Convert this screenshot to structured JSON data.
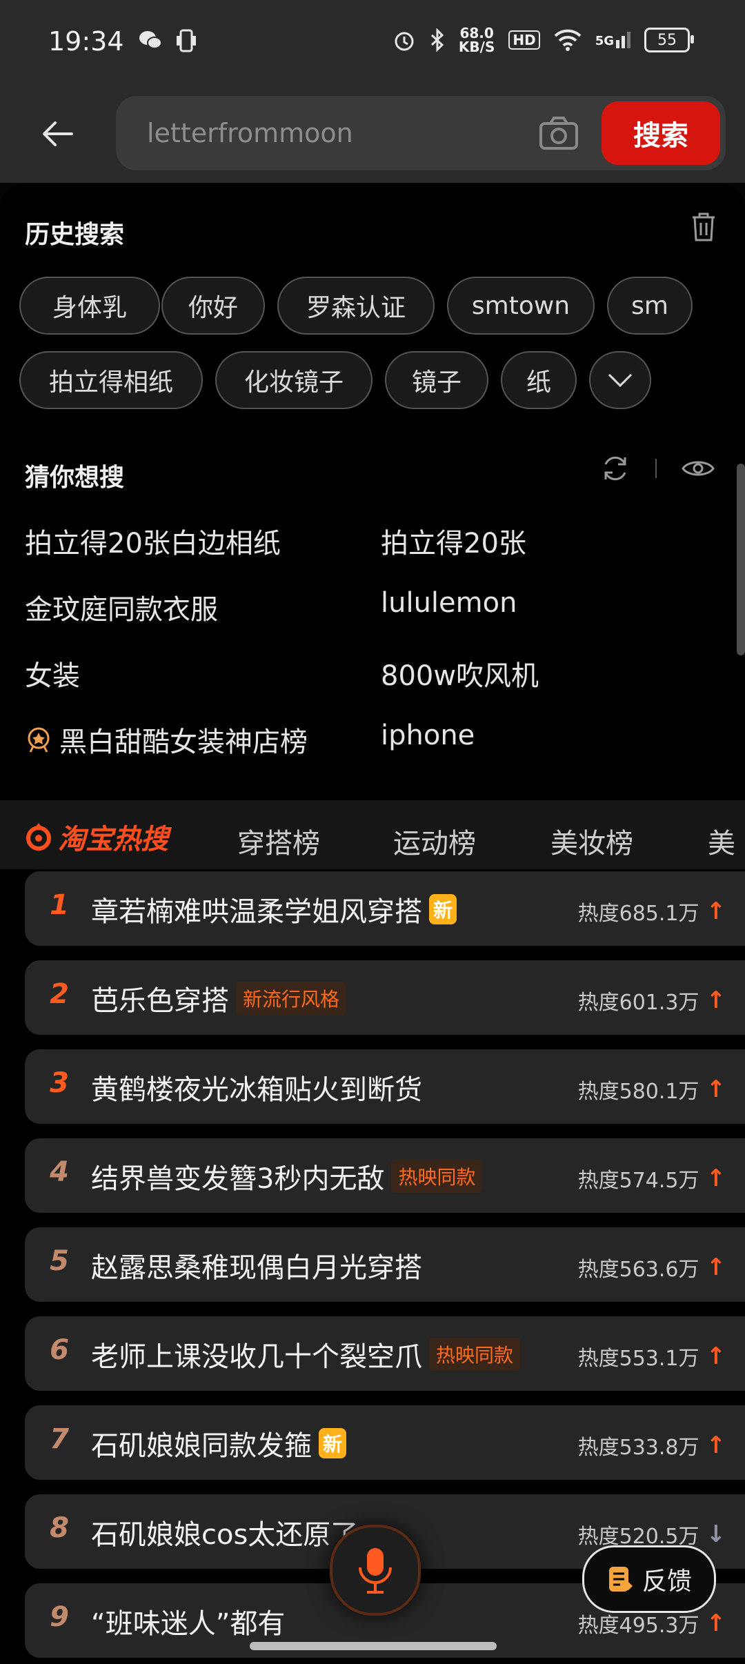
{
  "status_bar": {
    "time": "19:34",
    "speed_value": "68.0",
    "speed_unit": "KB/S",
    "hd": "HD",
    "network": "5G",
    "battery": "55"
  },
  "header": {
    "search_placeholder": "letterfrommoon",
    "search_button": "搜索"
  },
  "history": {
    "title": "历史搜索",
    "chips": [
      "身体乳",
      "你好",
      "罗森认证",
      "smtown",
      "sm",
      "拍立得相纸",
      "化妆镜子",
      "镜子",
      "纸"
    ]
  },
  "guess": {
    "title": "猜你想搜",
    "items": [
      "拍立得20张白边相纸",
      "拍立得20张",
      "金玟庭同款衣服",
      "lululemon",
      "女装",
      "800w吹风机",
      "黑白甜酷女装神店榜",
      "iphone"
    ]
  },
  "tabs": {
    "logo": "淘宝热搜",
    "items": [
      "穿搭榜",
      "运动榜",
      "美妆榜",
      "美"
    ]
  },
  "hot_list": [
    {
      "rank": "1",
      "title": "章若楠难哄温柔学姐风穿搭",
      "badge": "新",
      "badge_type": "new",
      "heat": "热度685.1万",
      "trend": "up"
    },
    {
      "rank": "2",
      "title": "芭乐色穿搭",
      "badge": "新流行风格",
      "badge_type": "tag",
      "heat": "热度601.3万",
      "trend": "up"
    },
    {
      "rank": "3",
      "title": "黄鹤楼夜光冰箱贴火到断货",
      "badge": "",
      "badge_type": "",
      "heat": "热度580.1万",
      "trend": "up"
    },
    {
      "rank": "4",
      "title": "结界兽变发簪3秒内无敌",
      "badge": "热映同款",
      "badge_type": "tag",
      "heat": "热度574.5万",
      "trend": "up"
    },
    {
      "rank": "5",
      "title": "赵露思桑稚现偶白月光穿搭",
      "badge": "",
      "badge_type": "",
      "heat": "热度563.6万",
      "trend": "up"
    },
    {
      "rank": "6",
      "title": "老师上课没收几十个裂空爪",
      "badge": "热映同款",
      "badge_type": "tag",
      "heat": "热度553.1万",
      "trend": "up"
    },
    {
      "rank": "7",
      "title": "石矶娘娘同款发箍",
      "badge": "新",
      "badge_type": "new",
      "heat": "热度533.8万",
      "trend": "up"
    },
    {
      "rank": "8",
      "title": "石矶娘娘cos太还原了",
      "badge": "",
      "badge_type": "",
      "heat": "热度520.5万",
      "trend": "down"
    },
    {
      "rank": "9",
      "title": "“班味迷人”都有",
      "badge": "",
      "badge_type": "",
      "heat": "热度495.3万",
      "trend": "up"
    }
  ],
  "feedback_label": "反馈",
  "colors": {
    "accent": "#d7150f",
    "rank_orange": "#ff5a1f",
    "badge_new": "#ffb11b"
  }
}
